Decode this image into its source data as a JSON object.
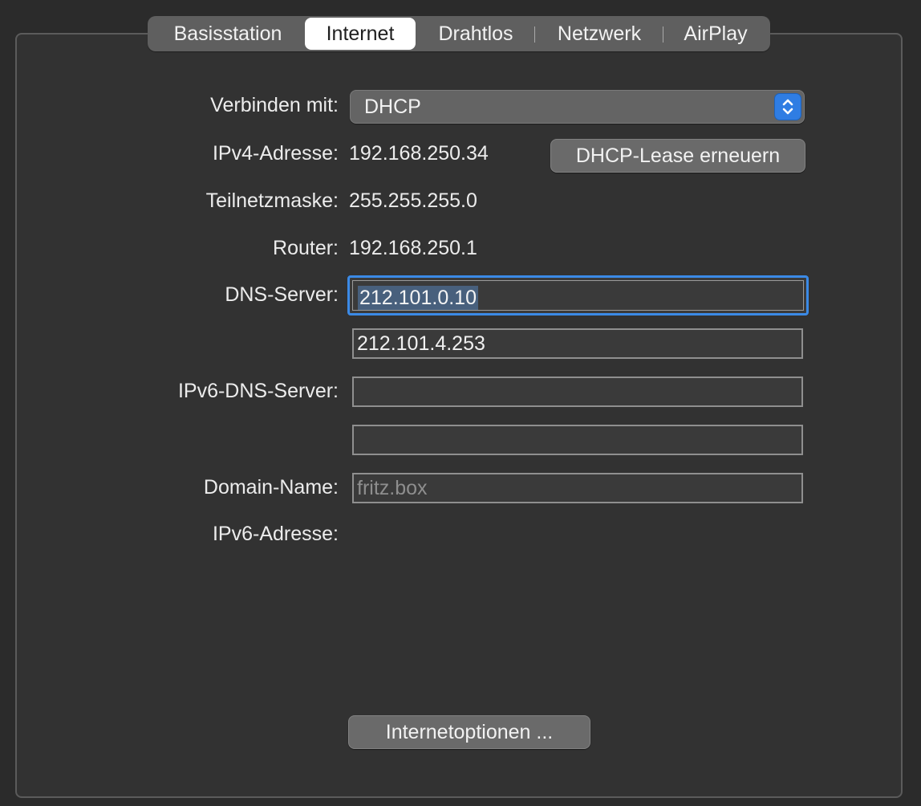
{
  "tabs": [
    {
      "label": "Basisstation",
      "active": false
    },
    {
      "label": "Internet",
      "active": true
    },
    {
      "label": "Drahtlos",
      "active": false
    },
    {
      "label": "Netzwerk",
      "active": false
    },
    {
      "label": "AirPlay",
      "active": false
    }
  ],
  "form": {
    "connect_label": "Verbinden mit:",
    "connect_value": "DHCP",
    "ipv4_label": "IPv4-Adresse:",
    "ipv4_value": "192.168.250.34",
    "renew_button": "DHCP-Lease erneuern",
    "subnet_label": "Teilnetzmaske:",
    "subnet_value": "255.255.255.0",
    "router_label": "Router:",
    "router_value": "192.168.250.1",
    "dns_label": "DNS-Server:",
    "dns1_value": "212.101.0.10",
    "dns2_value": "212.101.4.253",
    "ipv6dns_label": "IPv6-DNS-Server:",
    "ipv6dns1_value": "",
    "ipv6dns2_value": "",
    "domain_label": "Domain-Name:",
    "domain_placeholder": "fritz.box",
    "ipv6addr_label": "IPv6-Adresse:",
    "options_button": "Internetoptionen ..."
  },
  "colors": {
    "background": "#2b2b2b",
    "panel": "#323232",
    "accent": "#2f7de3",
    "focus_ring": "#3b8ae6",
    "selection": "#48607d"
  },
  "icons": {
    "select_arrows": "chevron-up-down-icon"
  }
}
